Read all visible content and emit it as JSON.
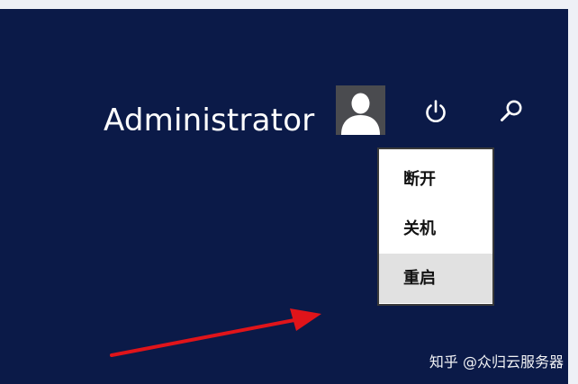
{
  "user": {
    "name": "Administrator"
  },
  "icons": {
    "avatar": "user-silhouette-icon",
    "power": "power-icon",
    "search": "search-icon"
  },
  "power_menu": {
    "items": [
      {
        "label": "断开",
        "highlighted": false
      },
      {
        "label": "关机",
        "highlighted": false
      },
      {
        "label": "重启",
        "highlighted": true
      }
    ]
  },
  "watermark": {
    "text": "知乎 @众归云服务器"
  },
  "colors": {
    "background": "#0b1a48",
    "menu_background": "#ffffff",
    "menu_highlight": "#e1e1e1",
    "arrow": "#e0141a"
  }
}
